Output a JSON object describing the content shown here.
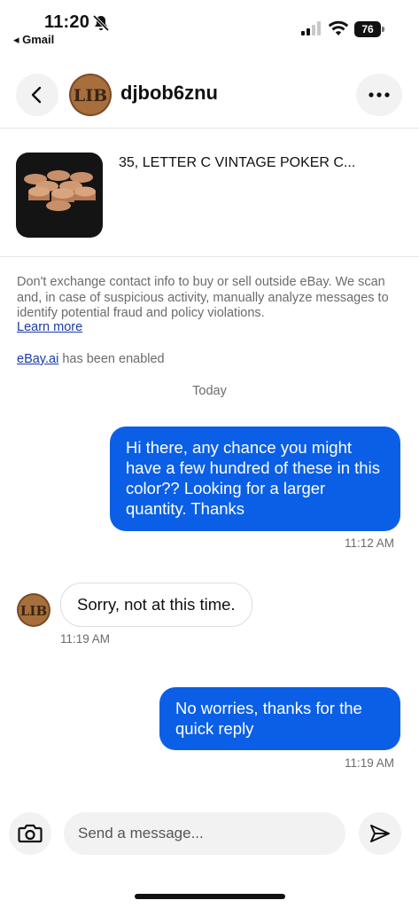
{
  "status_bar": {
    "time": "11:20",
    "back_app": "◂ Gmail",
    "battery": "76"
  },
  "header": {
    "username": "djbob6znu",
    "avatar_text": "LIB"
  },
  "item": {
    "title": "35, LETTER C VINTAGE POKER C..."
  },
  "notice": {
    "text": "Don't exchange contact info to buy or sell outside eBay. We scan and, in case of suspicious activity, manually analyze messages to identify potential fraud and policy violations.",
    "learn_more": "Learn more",
    "ai_link": "eBay.ai",
    "ai_suffix": " has been enabled"
  },
  "conversation": {
    "day_label": "Today",
    "messages": [
      {
        "direction": "outgoing",
        "text": "Hi there, any chance you might have a few hundred of these in this color?? Looking for a larger quantity. Thanks",
        "time": "11:12 AM"
      },
      {
        "direction": "incoming",
        "text": "Sorry, not at this time.",
        "time": "11:19 AM"
      },
      {
        "direction": "outgoing",
        "text": "No worries, thanks for the quick reply",
        "time": "11:19 AM"
      }
    ]
  },
  "composer": {
    "placeholder": "Send a message..."
  },
  "colors": {
    "outgoing_bubble": "#0a5fe6",
    "link": "#1a3ca6",
    "muted_text": "#6b6b6b",
    "button_bg": "#f2f2f2"
  },
  "icons": [
    "bell-off-icon",
    "cellular-signal-icon",
    "wifi-icon",
    "battery-icon",
    "back-arrow-icon",
    "more-dots-icon",
    "camera-icon",
    "send-icon"
  ]
}
